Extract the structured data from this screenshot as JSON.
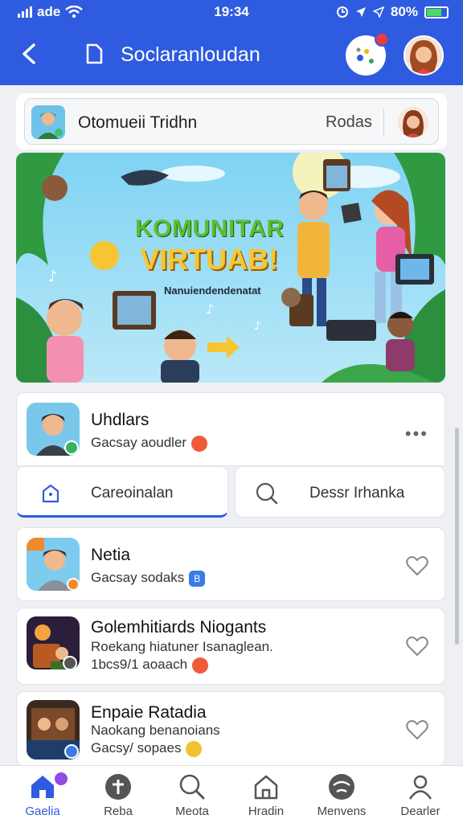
{
  "status_bar": {
    "carrier": "ade",
    "time": "19:34",
    "battery": "80%"
  },
  "header": {
    "title": "Soclaranloudan"
  },
  "search": {
    "placeholder": "Otomueii Tridhn",
    "button": "Rodas"
  },
  "banner": {
    "title_line1": "KOMUNITAR",
    "title_line2": "VIRTUAB!",
    "subtitle": "Nanuiendendenatat"
  },
  "profile_card": {
    "name": "Uhdlars",
    "subtitle": "Gacsay aoudler",
    "more": "•••"
  },
  "tabs": [
    {
      "label": "Careoinalan"
    },
    {
      "label": "Dessr Irhanka"
    }
  ],
  "list": [
    {
      "name": "Netia",
      "line1": "Gacsay sodaks",
      "badge": "B"
    },
    {
      "name": "Golemhitiards Niogants",
      "line1": "Roekang hiatuner Isanaglean.",
      "line2": "1bcs9/1 aoaach"
    },
    {
      "name": "Enpaie Ratadia",
      "line1": "Naokang benanoians",
      "line2": "Gacsy/ sopaes"
    }
  ],
  "bottom_nav": [
    {
      "label": "Gaelia",
      "icon": "home-icon"
    },
    {
      "label": "Reba",
      "icon": "plus-circle-icon"
    },
    {
      "label": "Meota",
      "icon": "search-icon"
    },
    {
      "label": "Hradin",
      "icon": "house-outline-icon"
    },
    {
      "label": "Menvens",
      "icon": "face-icon"
    },
    {
      "label": "Dearler",
      "icon": "person-icon"
    }
  ]
}
